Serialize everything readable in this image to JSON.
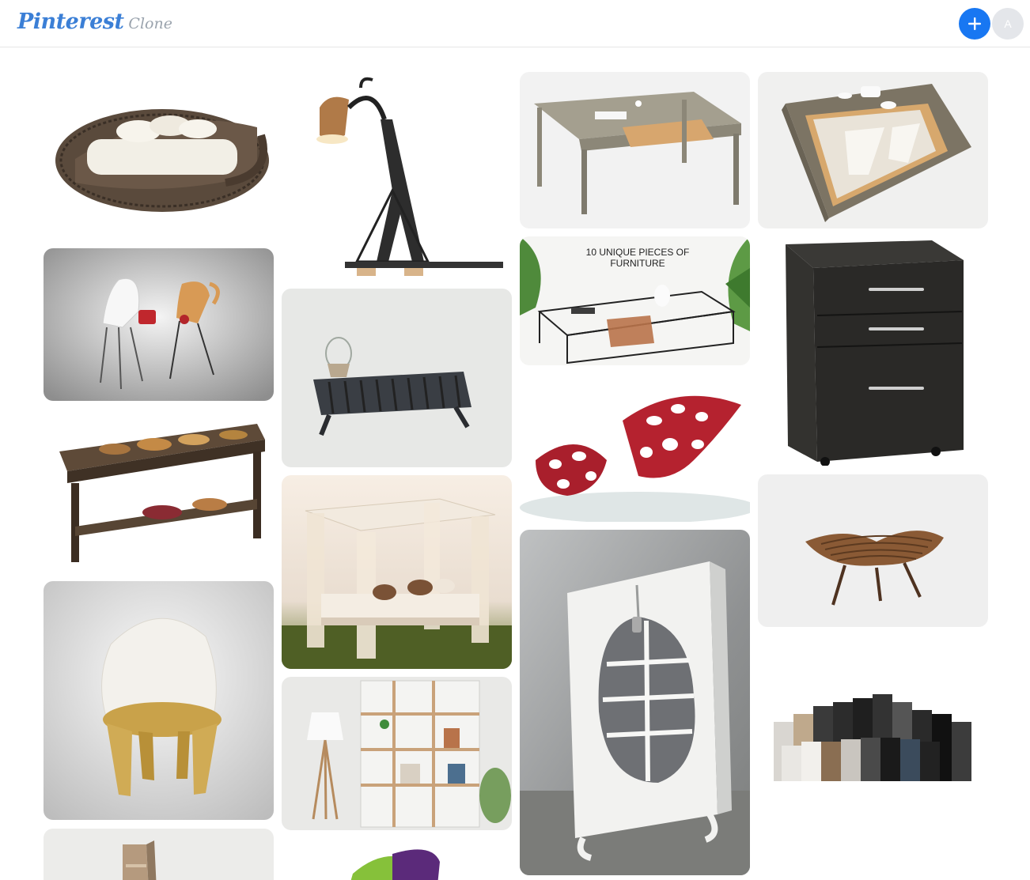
{
  "header": {
    "logo_main": "Pinterest",
    "logo_sub": "Clone",
    "avatar_letter": "A"
  },
  "colors": {
    "accent": "#1877f2",
    "logo": "#3b7fd6",
    "avatar_bg": "#e4e6ea"
  },
  "pins": {
    "col1": [
      {
        "name": "rattan-daybed"
      },
      {
        "name": "coffee-cup-chairs"
      },
      {
        "name": "basket-coffee-table"
      },
      {
        "name": "white-fur-gold-chair"
      },
      {
        "name": "wooden-wall-shelf"
      }
    ],
    "col2": [
      {
        "name": "eiffel-tower-lamp"
      },
      {
        "name": "dark-slatted-sideboard"
      },
      {
        "name": "canopy-outdoor-bed"
      },
      {
        "name": "wooden-bookshelf-lamp"
      },
      {
        "name": "green-purple-chair"
      }
    ],
    "col3": [
      {
        "name": "drawer-desk"
      },
      {
        "name": "unique-furniture-collage",
        "caption": "10 UNIQUE PIECES OF FURNITURE"
      },
      {
        "name": "red-organic-chairs"
      },
      {
        "name": "zipper-cabinet"
      }
    ],
    "col4": [
      {
        "name": "wedge-coffee-table"
      },
      {
        "name": "filing-cabinet"
      },
      {
        "name": "wooden-lounge-chair"
      },
      {
        "name": "block-sofa"
      }
    ]
  }
}
